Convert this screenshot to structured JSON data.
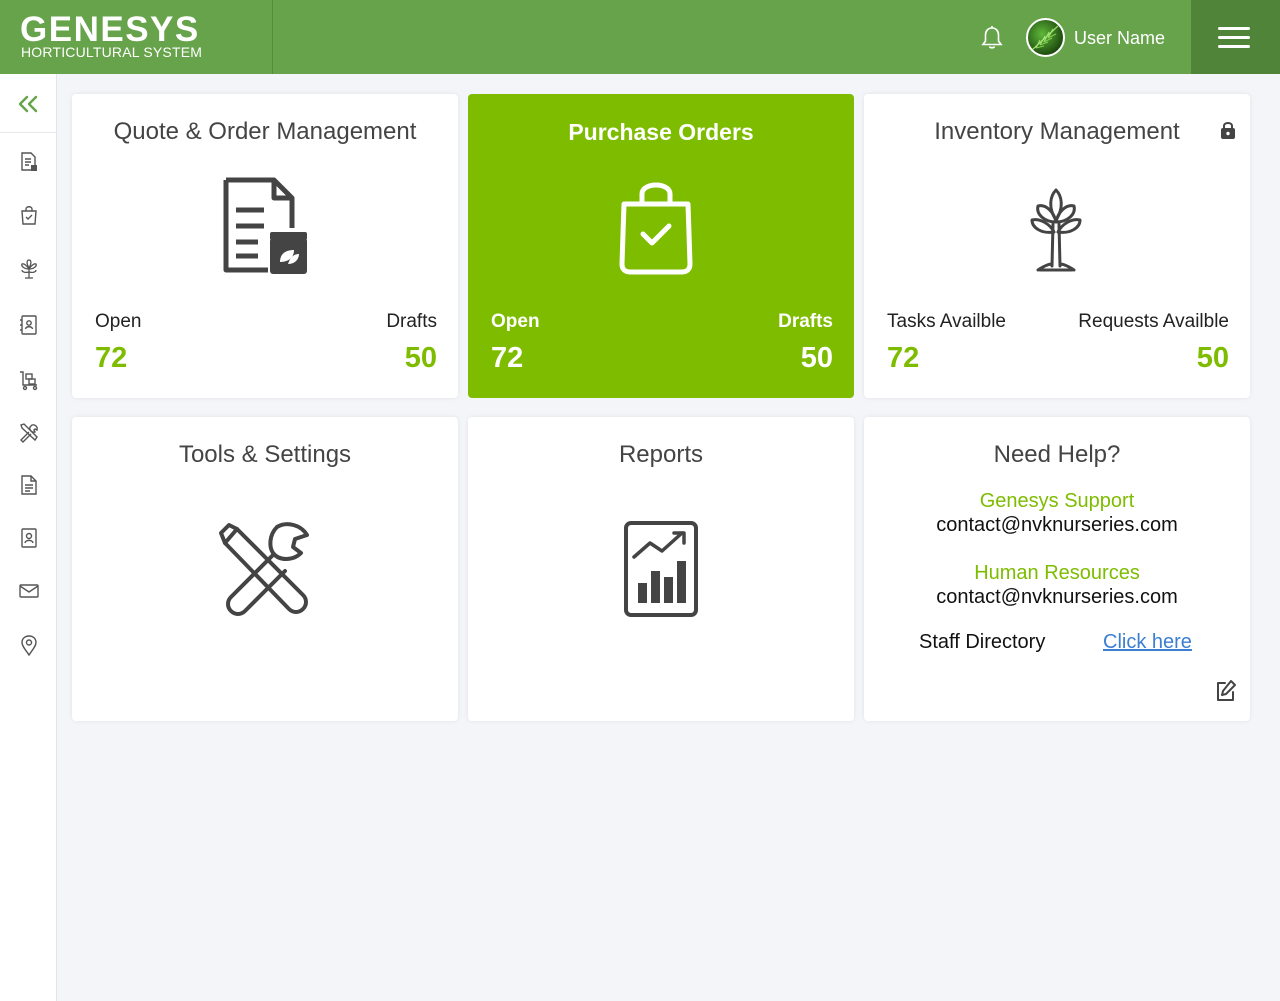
{
  "header": {
    "brand_title": "GENESYS",
    "brand_subtitle": "HORTICULTURAL SYSTEM",
    "user_name": "User Name",
    "accent_color": "#66a34a"
  },
  "sidebar": {
    "items": [
      {
        "icon": "document-icon"
      },
      {
        "icon": "shopping-bag-icon"
      },
      {
        "icon": "plant-icon"
      },
      {
        "icon": "contacts-book-icon"
      },
      {
        "icon": "cart-icon"
      },
      {
        "icon": "tools-icon"
      },
      {
        "icon": "report-document-icon"
      },
      {
        "icon": "staff-directory-icon"
      },
      {
        "icon": "mail-icon"
      },
      {
        "icon": "location-icon"
      }
    ]
  },
  "cards": {
    "quote": {
      "title": "Quote & Order Management",
      "left_label": "Open",
      "left_value": "72",
      "right_label": "Drafts",
      "right_value": "50"
    },
    "purchase": {
      "title": "Purchase Orders",
      "left_label": "Open",
      "left_value": "72",
      "right_label": "Drafts",
      "right_value": "50"
    },
    "inventory": {
      "title": "Inventory Management",
      "left_label": "Tasks Availble",
      "left_value": "72",
      "right_label": "Requests Availble",
      "right_value": "50"
    },
    "tools": {
      "title": "Tools & Settings"
    },
    "reports": {
      "title": "Reports"
    },
    "help": {
      "title": "Need Help?",
      "support_label": "Genesys Support",
      "support_email": "contact@nvknurseries.com",
      "hr_label": "Human Resources",
      "hr_email": "contact@nvknurseries.com",
      "staff_label": "Staff Directory",
      "staff_link": "Click here"
    }
  },
  "colors": {
    "highlight": "#7ebc00",
    "link": "#3b7fd1"
  }
}
